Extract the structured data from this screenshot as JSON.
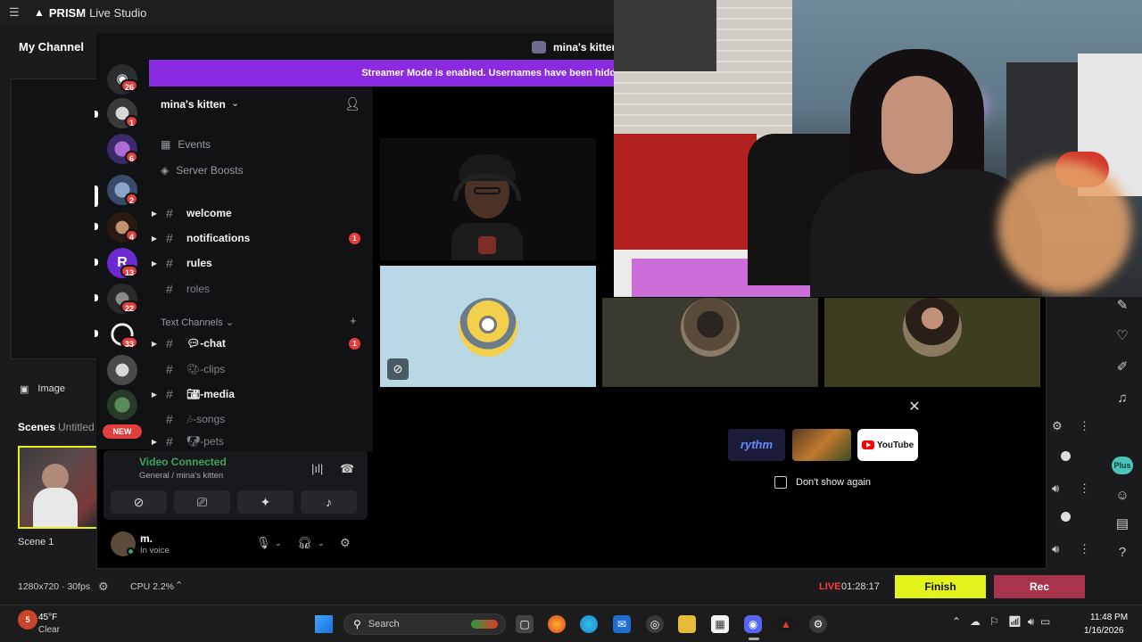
{
  "prism": {
    "menu_icon": "hamburger-icon",
    "brand": "PRISM",
    "product": "Live Studio",
    "my_channel": "My Channel",
    "source_image_label": "Image",
    "scenes_label": "Scenes",
    "untitled_label": "Untitled",
    "scene_name": "Scene 1",
    "resolution": "1280x720 · 30fps",
    "cpu": "CPU 2.2%",
    "live_label": "LIVE",
    "live_time": "01:28:17",
    "finish_label": "Finish",
    "rec_label": "Rec",
    "plus_badge": "Plus",
    "colors": {
      "finish": "#e3f21b",
      "rec": "#a8344b",
      "live": "#ff3b3b"
    }
  },
  "discord": {
    "window_title": "mina's kitten",
    "banner": "Streamer Mode is enabled. Usernames have been hidden.",
    "server_name": "mina's kitten",
    "guild_badges": [
      "26",
      "1",
      "6",
      "2",
      "4",
      "13",
      "22",
      "33"
    ],
    "new_badge": "NEW",
    "sidebar_links": [
      "Events",
      "Server Boosts"
    ],
    "channels_top": [
      {
        "name": "welcome",
        "badge": ""
      },
      {
        "name": "notifications",
        "badge": "1"
      },
      {
        "name": "rules",
        "badge": ""
      },
      {
        "name": "roles",
        "badge": ""
      }
    ],
    "category": "Text Channels",
    "channels_text": [
      {
        "name": "-chat",
        "badge": "1"
      },
      {
        "name": "-clips",
        "badge": ""
      },
      {
        "name": "-media",
        "badge": ""
      },
      {
        "name": "-songs",
        "badge": ""
      },
      {
        "name": "-pets",
        "badge": ""
      }
    ],
    "voice_status": "Video Connected",
    "voice_channel": "General / mina's kitten",
    "user_name": "m.",
    "user_status": "In voice",
    "dialog": {
      "apps": [
        "rythm",
        "",
        "YouTube"
      ],
      "dont_show": "Don't show again"
    }
  },
  "taskbar": {
    "weather_badge": "5",
    "temperature": "45°F",
    "condition": "Clear",
    "search_placeholder": "Search",
    "time": "11:48 PM",
    "date": "1/16/2026"
  }
}
